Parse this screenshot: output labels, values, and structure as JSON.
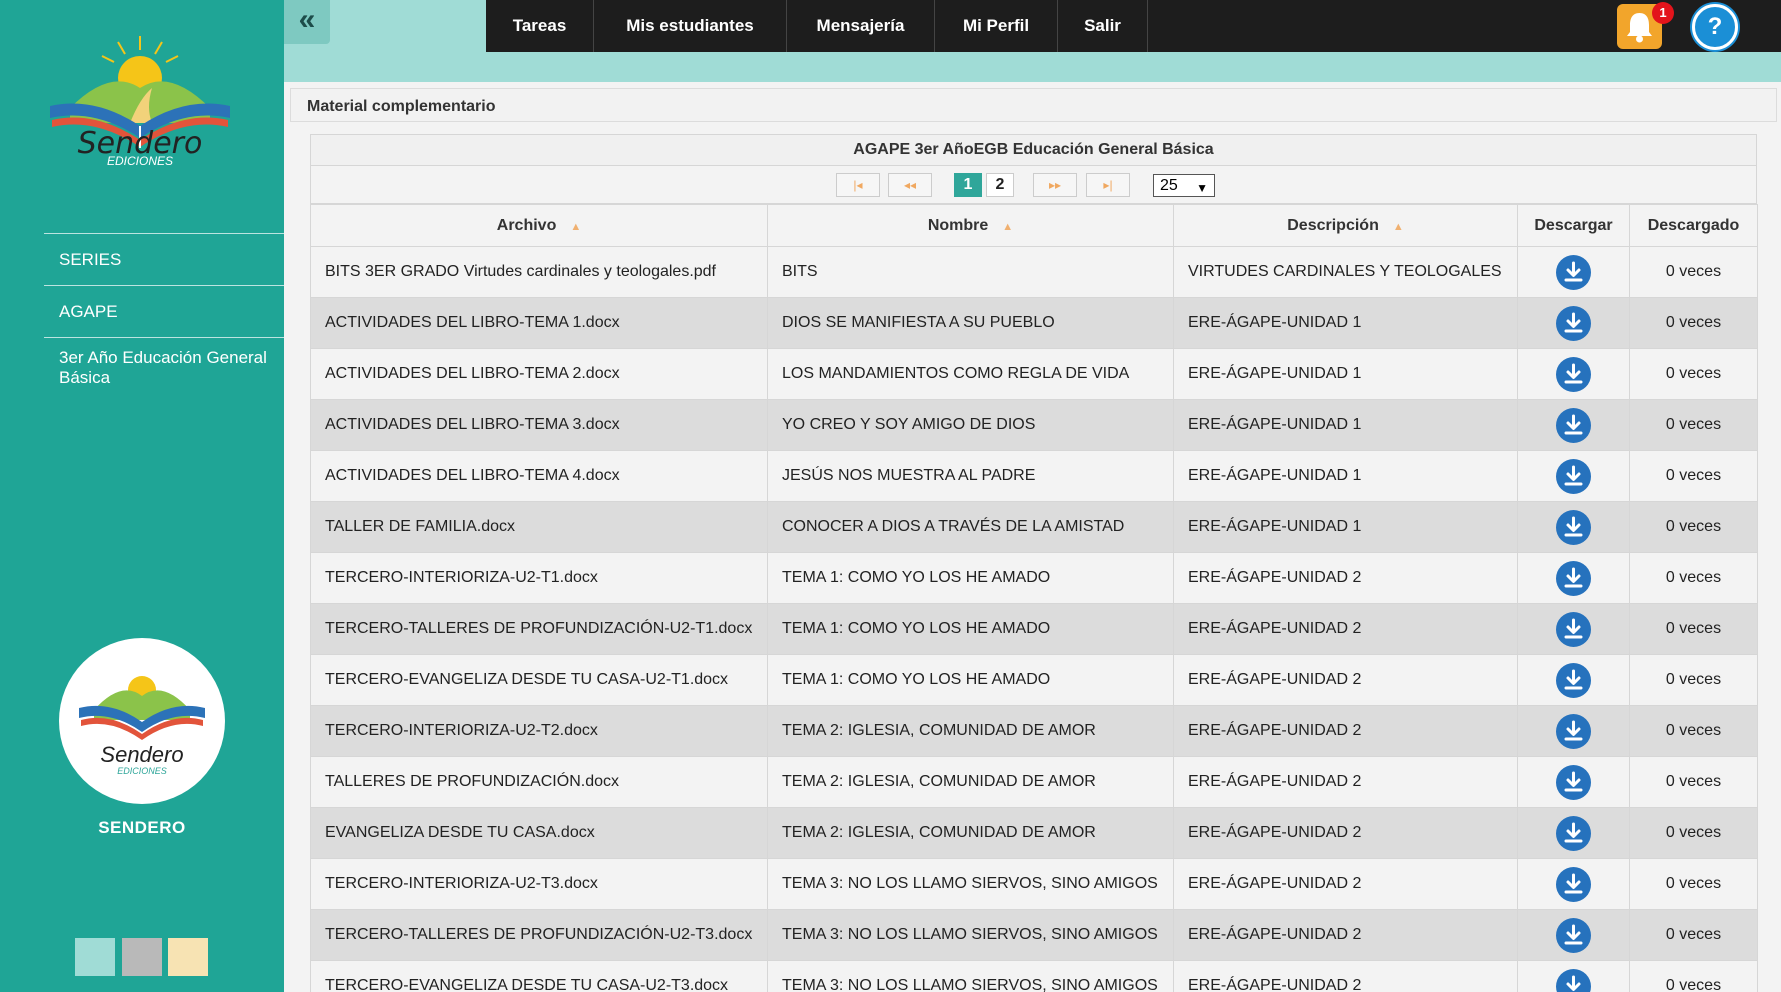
{
  "sidebar": {
    "logo_text": "Sendero",
    "logo_sub": "EDICIONES",
    "items": [
      {
        "label": "SERIES"
      },
      {
        "label": "AGAPE"
      },
      {
        "label": "3er Año Educación General Básica"
      }
    ],
    "brand_label": "SENDERO",
    "swatches": [
      "#a0dcd6",
      "#b9b9b9",
      "#f7e3b3"
    ]
  },
  "topbar": {
    "nav": [
      "Tareas",
      "Mis estudiantes",
      "Mensajería",
      "Mi Perfil",
      "Salir"
    ],
    "notification_count": "1",
    "help_label": "?"
  },
  "panel": {
    "title": "Material complementario"
  },
  "grid": {
    "caption": "AGAPE 3er AñoEGB Educación General Básica",
    "pager": {
      "pages": [
        "1",
        "2"
      ],
      "current_page": "1",
      "page_size": "25"
    },
    "columns": [
      "Archivo",
      "Nombre",
      "Descripción",
      "Descargar",
      "Descargado"
    ],
    "rows": [
      {
        "archivo": "BITS 3ER GRADO Virtudes cardinales y teologales.pdf",
        "nombre": "BITS",
        "descripcion": "VIRTUDES CARDINALES Y TEOLOGALES",
        "descargado": "0 veces"
      },
      {
        "archivo": "ACTIVIDADES DEL LIBRO-TEMA 1.docx",
        "nombre": "DIOS SE MANIFIESTA A SU PUEBLO",
        "descripcion": "ERE-ÁGAPE-UNIDAD 1",
        "descargado": "0 veces"
      },
      {
        "archivo": "ACTIVIDADES DEL LIBRO-TEMA 2.docx",
        "nombre": "LOS MANDAMIENTOS COMO REGLA DE VIDA",
        "descripcion": "ERE-ÁGAPE-UNIDAD 1",
        "descargado": "0 veces"
      },
      {
        "archivo": "ACTIVIDADES DEL LIBRO-TEMA 3.docx",
        "nombre": "YO CREO Y SOY AMIGO DE DIOS",
        "descripcion": "ERE-ÁGAPE-UNIDAD 1",
        "descargado": "0 veces"
      },
      {
        "archivo": "ACTIVIDADES DEL LIBRO-TEMA 4.docx",
        "nombre": "JESÚS NOS MUESTRA AL PADRE",
        "descripcion": "ERE-ÁGAPE-UNIDAD 1",
        "descargado": "0 veces"
      },
      {
        "archivo": "TALLER DE FAMILIA.docx",
        "nombre": "CONOCER A DIOS A TRAVÉS DE LA AMISTAD",
        "descripcion": "ERE-ÁGAPE-UNIDAD 1",
        "descargado": "0 veces"
      },
      {
        "archivo": "TERCERO-INTERIORIZA-U2-T1.docx",
        "nombre": "TEMA 1: COMO YO LOS HE AMADO",
        "descripcion": "ERE-ÁGAPE-UNIDAD 2",
        "descargado": "0 veces"
      },
      {
        "archivo": "TERCERO-TALLERES DE PROFUNDIZACIÓN-U2-T1.docx",
        "nombre": "TEMA 1: COMO YO LOS HE AMADO",
        "descripcion": "ERE-ÁGAPE-UNIDAD 2",
        "descargado": "0 veces"
      },
      {
        "archivo": "TERCERO-EVANGELIZA DESDE TU CASA-U2-T1.docx",
        "nombre": "TEMA 1: COMO YO LOS HE AMADO",
        "descripcion": "ERE-ÁGAPE-UNIDAD 2",
        "descargado": "0 veces"
      },
      {
        "archivo": "TERCERO-INTERIORIZA-U2-T2.docx",
        "nombre": "TEMA 2: IGLESIA, COMUNIDAD DE AMOR",
        "descripcion": "ERE-ÁGAPE-UNIDAD 2",
        "descargado": "0 veces"
      },
      {
        "archivo": "TALLERES DE PROFUNDIZACIÓN.docx",
        "nombre": "TEMA 2: IGLESIA, COMUNIDAD DE AMOR",
        "descripcion": "ERE-ÁGAPE-UNIDAD 2",
        "descargado": "0 veces"
      },
      {
        "archivo": "EVANGELIZA DESDE TU CASA.docx",
        "nombre": "TEMA 2: IGLESIA, COMUNIDAD DE AMOR",
        "descripcion": "ERE-ÁGAPE-UNIDAD 2",
        "descargado": "0 veces"
      },
      {
        "archivo": "TERCERO-INTERIORIZA-U2-T3.docx",
        "nombre": "TEMA 3: NO LOS LLAMO SIERVOS, SINO AMIGOS",
        "descripcion": "ERE-ÁGAPE-UNIDAD 2",
        "descargado": "0 veces"
      },
      {
        "archivo": "TERCERO-TALLERES DE PROFUNDIZACIÓN-U2-T3.docx",
        "nombre": "TEMA 3: NO LOS LLAMO SIERVOS, SINO AMIGOS",
        "descripcion": "ERE-ÁGAPE-UNIDAD 2",
        "descargado": "0 veces"
      },
      {
        "archivo": "TERCERO-EVANGELIZA DESDE TU CASA-U2-T3.docx",
        "nombre": "TEMA 3: NO LOS LLAMO SIERVOS, SINO AMIGOS",
        "descripcion": "ERE-ÁGAPE-UNIDAD 2",
        "descargado": "0 veces"
      }
    ]
  },
  "colors": {
    "sidebar": "#1fa596",
    "topbar_accent": "#a0dcd6",
    "navbar": "#1d1d1d",
    "download_button": "#2672bd",
    "bell": "#f2a52b"
  },
  "icons": {
    "collapse": "double-chevron-left-icon",
    "bell": "bell-icon",
    "help": "question-icon",
    "download": "download-arrow-icon",
    "sort": "sort-arrows-icon"
  }
}
